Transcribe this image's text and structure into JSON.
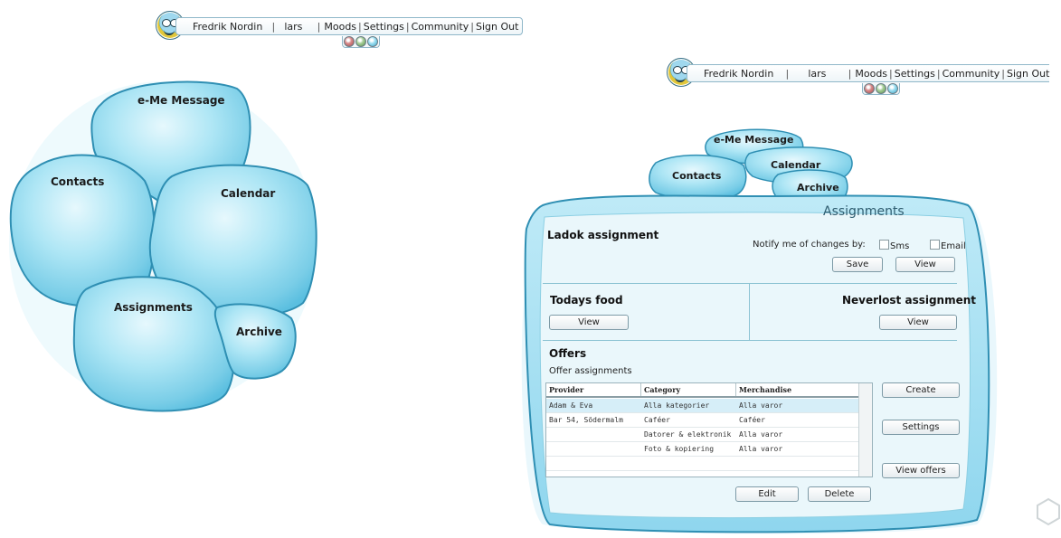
{
  "user_bar": {
    "name": "Fredrik Nordin",
    "sep": "|",
    "username": "lars",
    "links": [
      "Moods",
      "Settings",
      "Community",
      "Sign Out"
    ]
  },
  "main_menu": {
    "message": "e-Me Message",
    "contacts": "Contacts",
    "calendar": "Calendar",
    "assignments": "Assignments",
    "archive": "Archive"
  },
  "assignments_panel": {
    "title": "Assignments",
    "ladok": {
      "title": "Ladok assignment",
      "notify_label": "Notify me of changes by:",
      "sms_label": "Sms",
      "email_label": "Email",
      "save_label": "Save",
      "view_label": "View"
    },
    "todays_food": {
      "title": "Todays food",
      "view_label": "View"
    },
    "neverlost": {
      "title": "Neverlost assignment",
      "view_label": "View"
    },
    "offers": {
      "title": "Offers",
      "subtitle": "Offer assignments",
      "columns": [
        "Provider",
        "Category",
        "Merchandise"
      ],
      "rows": [
        [
          "Adam & Eva",
          "Alla kategorier",
          "Alla varor"
        ],
        [
          "Bar 54, Södermalm",
          "Caféer",
          "Caféer"
        ],
        [
          "",
          "Datorer & elektronik",
          "Alla varor"
        ],
        [
          "",
          "Foto & kopiering",
          "Alla varor"
        ]
      ],
      "create_label": "Create",
      "settings_label": "Settings",
      "view_offers_label": "View offers",
      "edit_label": "Edit",
      "delete_label": "Delete"
    }
  },
  "colors": {
    "bubble_light": "#c8eef9",
    "bubble_mid": "#8fd8ef",
    "bubble_edge": "#2f8fb3",
    "panel_bg": "#eaf7fb"
  }
}
